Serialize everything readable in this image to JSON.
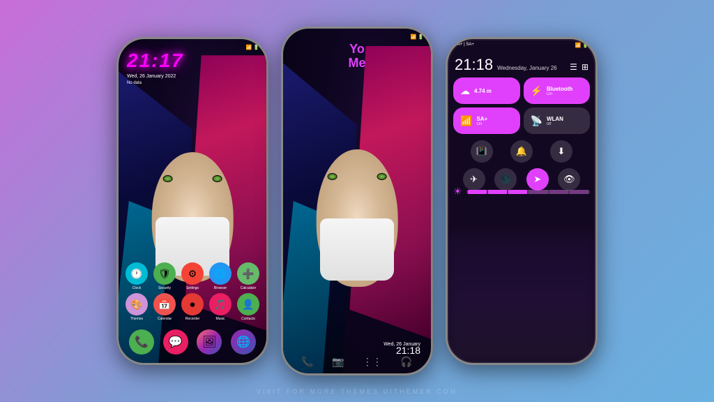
{
  "background": {
    "gradient": "linear-gradient(135deg, #c96dd8, #7b9fd4, #6ab0e0)"
  },
  "watermark": "VISIT FOR MORE THEMES UITHEMER.COM",
  "phone1": {
    "time": "21:17",
    "date": "Wed, 26 January 2022",
    "no_data": "No data",
    "apps_row1": [
      {
        "label": "Clock",
        "icon": "🕐",
        "class": "icon-clock"
      },
      {
        "label": "Security",
        "icon": "🛡",
        "class": "icon-security"
      },
      {
        "label": "Settings",
        "icon": "⚙",
        "class": "icon-settings"
      },
      {
        "label": "Browser",
        "icon": "🌐",
        "class": "icon-browser"
      },
      {
        "label": "Calculator",
        "icon": "➕",
        "class": "icon-calc"
      }
    ],
    "apps_row2": [
      {
        "label": "Themes",
        "icon": "🎨",
        "class": "icon-themes"
      },
      {
        "label": "Calendar",
        "icon": "📅",
        "class": "icon-calendar"
      },
      {
        "label": "Recorder",
        "icon": "⏺",
        "class": "icon-recorder"
      },
      {
        "label": "Music",
        "icon": "🎵",
        "class": "icon-music"
      },
      {
        "label": "Contacts",
        "icon": "👤",
        "class": "icon-contacts"
      }
    ],
    "dock": [
      {
        "label": "Phone",
        "icon": "📞",
        "class": "dock-phone"
      },
      {
        "label": "Messages",
        "icon": "💬",
        "class": "dock-msg"
      },
      {
        "label": "Gallery",
        "icon": "🖼",
        "class": "dock-gallery"
      },
      {
        "label": "Browser",
        "icon": "🌐",
        "class": "dock-browser2"
      }
    ]
  },
  "phone2": {
    "logo_line1": "Yo",
    "logo_line2": "Me",
    "date": "Wed, 26 January",
    "time": "21:18"
  },
  "phone3": {
    "status_left": "SA+ | SA+",
    "time": "21:18",
    "date": "Wednesday, January 26",
    "tiles": [
      {
        "title": "4.74 m",
        "subtitle": "",
        "icon": "☁",
        "active": true
      },
      {
        "title": "Bluetooth",
        "subtitle": "On",
        "icon": "⚡",
        "active": true
      },
      {
        "title": "SA+",
        "subtitle": "On",
        "icon": "📶",
        "active": true
      },
      {
        "title": "WLAN",
        "subtitle": "off",
        "icon": "📡",
        "active": false
      }
    ],
    "controls_row1": [
      {
        "icon": "📳",
        "active": false
      },
      {
        "icon": "🔔",
        "active": false
      },
      {
        "icon": "⬇",
        "active": false
      }
    ],
    "controls_row2": [
      {
        "icon": "✈",
        "active": false
      },
      {
        "icon": "🌑",
        "active": false
      },
      {
        "icon": "➤",
        "active": true
      },
      {
        "icon": "👁",
        "active": false
      }
    ]
  }
}
